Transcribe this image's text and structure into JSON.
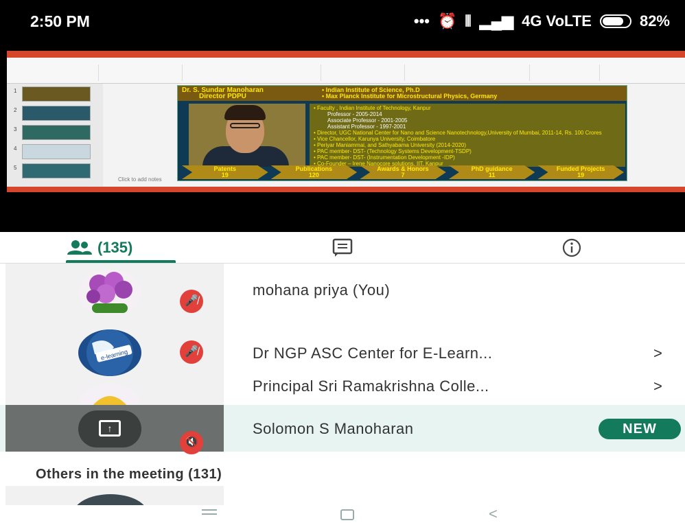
{
  "status_bar": {
    "time": "2:50 PM",
    "icons": [
      "more-dots-icon",
      "alarm-icon",
      "vibrate-icon",
      "signal-icon"
    ],
    "network": "4G VoLTE",
    "battery": "82%",
    "battery_level": 0.82
  },
  "slide": {
    "name_line1": "Dr. S. Sundar Manoharan",
    "name_line2": "Director PDPU",
    "edu_line1": "• Indian Institute of Science, Ph.D",
    "edu_line2": "• Max Planck Institute for Microstructural Physics, Germany",
    "bullets": [
      {
        "text": "• Faculty , Indian Institute of Technology, Kanpur",
        "sub": false
      },
      {
        "text": "Professor - 2005-2014",
        "sub": true
      },
      {
        "text": "Associate Professor - 2001-2005",
        "sub": true
      },
      {
        "text": "Assistant Professor - 1997-2001",
        "sub": true
      },
      {
        "text": "• Director, UGC National Center for Nano and Science Nanotechnology,University of Mumbai, 2011-14, Rs. 100 Crores",
        "sub": false
      },
      {
        "text": "• Vice Chancellor, Karunya University, Coimbatore",
        "sub": false
      },
      {
        "text": "• Periyar Maniammai, and Sathyabama University (2014-2020)",
        "sub": false
      },
      {
        "text": "• PAC member- DST- (Technology Systems Development-TSDP)",
        "sub": false
      },
      {
        "text": "• PAC member- DST- (Instrumentation Development -IDP)",
        "sub": false
      },
      {
        "text": "• Co-Founder – Irene Nanocore solutions, IIT, Kanpur",
        "sub": false
      }
    ],
    "stats": [
      {
        "label": "Patents",
        "value": "19"
      },
      {
        "label": "Publications",
        "value": "120"
      },
      {
        "label": "Awards & Honors",
        "value": "7"
      },
      {
        "label": "PhD guidance",
        "value": "11"
      },
      {
        "label": "Funded Projects",
        "value": "19"
      }
    ],
    "notes_placeholder": "Click to add notes"
  },
  "tabs": {
    "people_count": "(135)",
    "people_icon": "people-icon",
    "chat_icon": "chat-icon",
    "info_icon": "info-icon"
  },
  "participants": [
    {
      "name": "mohana priya (You)",
      "icon": "mic-off-icon",
      "chevron": ""
    },
    {
      "name": "Dr NGP ASC Center for E-Learn...",
      "icon": "mic-off-icon",
      "chevron": ">"
    },
    {
      "name": "Principal Sri Ramakrishna Colle...",
      "icon": "more-dots-icon",
      "chevron": ">"
    },
    {
      "name": "Solomon S Manoharan",
      "icon": "volume-off-icon",
      "badge": "NEW"
    }
  ],
  "presenting_icon": "present-screen-icon",
  "others": {
    "label": "Others in the meeting (131)"
  },
  "nav": {
    "menu_icon": "menu-icon",
    "home_icon": "home-icon",
    "back_icon": "back-icon"
  },
  "colors": {
    "accent": "#137a5c",
    "mute_red": "#e2403a",
    "active_row": "#e8f4f1"
  }
}
